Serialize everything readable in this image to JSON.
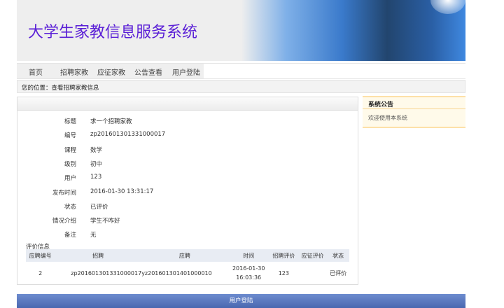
{
  "header": {
    "title": "大学生家教信息服务系统"
  },
  "nav": [
    "首页",
    "招聘家教",
    "应征家教",
    "公告查看",
    "用户登陆"
  ],
  "breadcrumb": "您的位置：查看招聘家教信息",
  "detail": [
    {
      "label": "标题",
      "value": "求一个招聘家教"
    },
    {
      "label": "编号",
      "value": "zp201601301331000017"
    },
    {
      "label": "课程",
      "value": "数学"
    },
    {
      "label": "级别",
      "value": "初中"
    },
    {
      "label": "用户",
      "value": "123"
    },
    {
      "label": "发布时间",
      "value": "2016-01-30 13:31:17"
    },
    {
      "label": "状态",
      "value": "已评价"
    },
    {
      "label": "情况介绍",
      "value": "学生不咋好"
    },
    {
      "label": "备注",
      "value": "无"
    }
  ],
  "evaluation": {
    "title": "评价信息",
    "columns": [
      "应聘编号",
      "招聘",
      "应聘",
      "时间",
      "招聘评价",
      "应征评价",
      "状态"
    ],
    "rows": [
      {
        "id": "2",
        "recruit": "zp201601301331000017",
        "apply": "yz201601301401000010",
        "date": "2016-01-30",
        "time": "16:03:36",
        "recruit_eval": "123",
        "apply_eval": "",
        "status": "已评价"
      }
    ]
  },
  "notice": {
    "title": "系统公告",
    "body": "欢迎使用本系统"
  },
  "footer": "用户登陆"
}
